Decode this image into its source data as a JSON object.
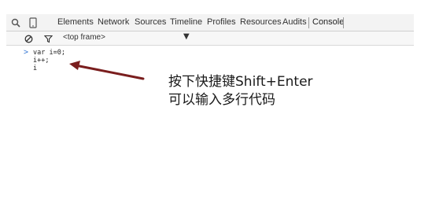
{
  "toolbar": {
    "tabs": [
      {
        "label": "Elements"
      },
      {
        "label": "Network"
      },
      {
        "label": "Sources"
      },
      {
        "label": "Timeline"
      },
      {
        "label": "Profiles"
      },
      {
        "label": "Resources"
      },
      {
        "label": "Audits"
      },
      {
        "label": "Console",
        "active": true
      }
    ],
    "icons": [
      "search-icon",
      "device-mode-icon"
    ]
  },
  "console_toolbar": {
    "frame_select": "<top frame>",
    "icons": [
      "clear-console-icon",
      "filter-icon",
      "dropdown-caret-icon"
    ]
  },
  "console": {
    "prompt_symbol": ">",
    "lines": [
      "var i=0;",
      "i++;",
      "i"
    ]
  },
  "annotation": {
    "line1": "按下快捷键Shift+Enter",
    "line2": "可以输入多行代码",
    "color": "#7a1e1e"
  }
}
